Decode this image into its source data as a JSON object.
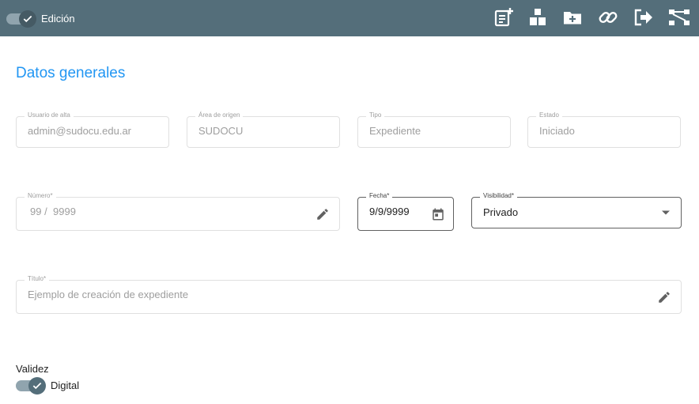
{
  "topbar": {
    "edit_toggle_label": "Edición",
    "edit_toggle_on": true,
    "icons": [
      "note-add-icon",
      "boxes-icon",
      "folder-add-icon",
      "link-icon",
      "exit-icon",
      "hierarchy-icon"
    ]
  },
  "section": {
    "title": "Datos generales"
  },
  "fields": {
    "usuario": {
      "label": "Usuario de alta",
      "value": "admin@sudocu.edu.ar"
    },
    "area": {
      "label": "Área de origen",
      "value": "SUDOCU"
    },
    "tipo": {
      "label": "Tipo",
      "value": "Expediente"
    },
    "estado": {
      "label": "Estado",
      "value": "Iniciado"
    },
    "numero": {
      "label": "Número*",
      "value_prefix": "99 /",
      "value_year": "9999"
    },
    "fecha": {
      "label": "Fecha*",
      "value": "9/9/9999"
    },
    "visibilidad": {
      "label": "Visibilidad*",
      "value": "Privado"
    },
    "titulo": {
      "label": "Título*",
      "value": "Ejemplo de creación de expediente"
    }
  },
  "validez": {
    "label": "Validez",
    "toggle_label": "Digital",
    "toggle_on": true
  },
  "colors": {
    "topbar": "#546e7a",
    "accent": "#2196f3",
    "toggle_thumb": "#546e7a"
  }
}
